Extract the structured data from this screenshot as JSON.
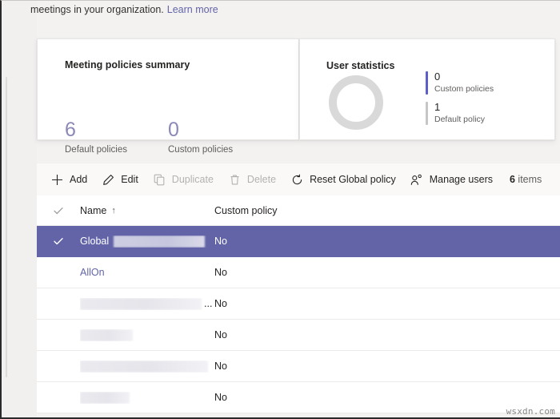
{
  "intro": {
    "text": "meetings in your organization.",
    "link_label": "Learn more"
  },
  "cards": {
    "policies": {
      "title": "Meeting policies summary",
      "stats": [
        {
          "value": "6",
          "label": "Default policies"
        },
        {
          "value": "0",
          "label": "Custom policies"
        }
      ]
    },
    "users": {
      "title": "User statistics",
      "legend": [
        {
          "value": "0",
          "label": "Custom policies",
          "color": "#5b5fc7"
        },
        {
          "value": "1",
          "label": "Default policy",
          "color": "#c8c6c4"
        }
      ],
      "donut_color": "#d9d9d9"
    }
  },
  "toolbar": {
    "add_label": "Add",
    "edit_label": "Edit",
    "duplicate_label": "Duplicate",
    "delete_label": "Delete",
    "reset_label": "Reset Global policy",
    "manage_users_label": "Manage users",
    "item_count": "6",
    "item_count_suffix": "items"
  },
  "table": {
    "columns": {
      "name": "Name",
      "sort_indicator": "↑",
      "custom_policy": "Custom policy"
    },
    "rows": [
      {
        "name": "Global",
        "redacted": true,
        "redact_width": 114,
        "ellipsis": false,
        "custom_policy": "No",
        "selected": true,
        "is_link": false
      },
      {
        "name": "AllOn",
        "redacted": false,
        "redact_width": 0,
        "ellipsis": false,
        "custom_policy": "No",
        "selected": false,
        "is_link": true
      },
      {
        "name": "",
        "redacted": true,
        "redact_width": 152,
        "ellipsis": true,
        "custom_policy": "No",
        "selected": false,
        "is_link": false
      },
      {
        "name": "",
        "redacted": true,
        "redact_width": 66,
        "ellipsis": false,
        "custom_policy": "No",
        "selected": false,
        "is_link": false
      },
      {
        "name": "",
        "redacted": true,
        "redact_width": 160,
        "ellipsis": false,
        "custom_policy": "No",
        "selected": false,
        "is_link": false
      },
      {
        "name": "",
        "redacted": true,
        "redact_width": 62,
        "ellipsis": false,
        "custom_policy": "No",
        "selected": false,
        "is_link": false
      }
    ]
  },
  "watermark": "wsxdn.com",
  "colors": {
    "accent": "#6264a7",
    "page_bg": "#f3f2f1",
    "toolbar_bg": "#faf9f8"
  }
}
